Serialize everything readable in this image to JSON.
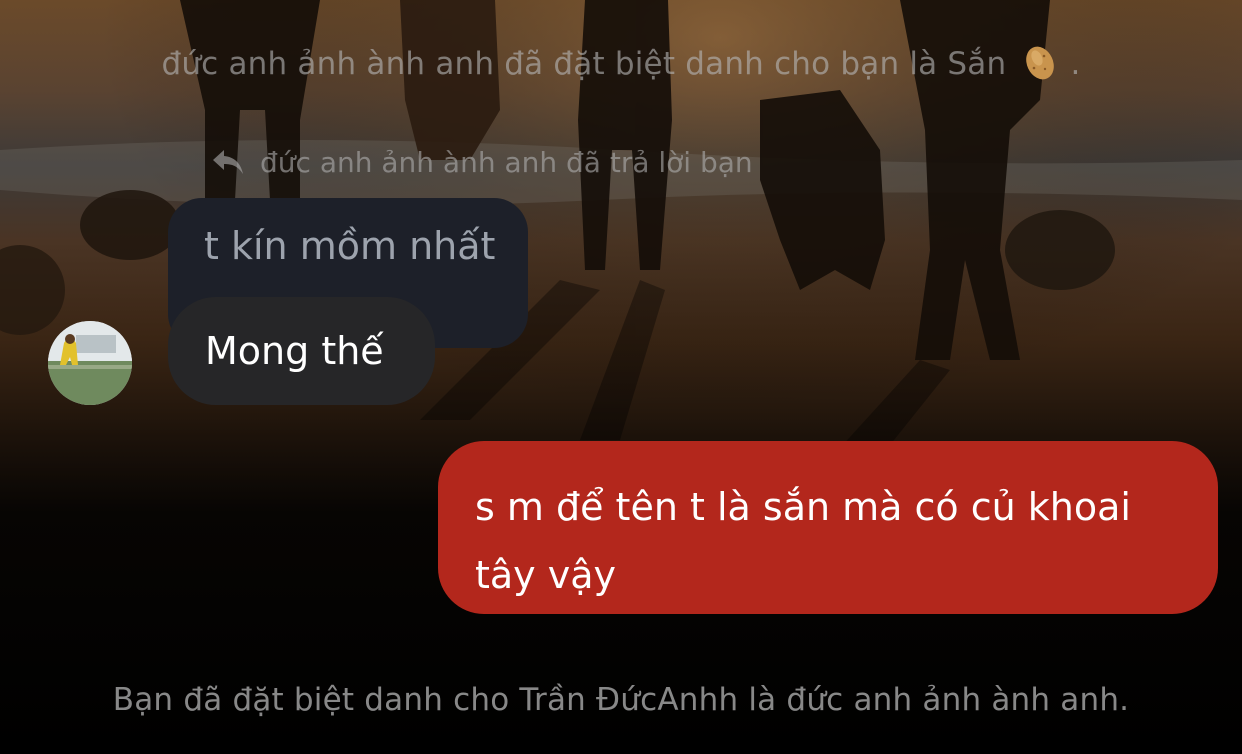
{
  "conversation": {
    "system_notes": {
      "top": "đức anh ảnh ành anh đã đặt biệt danh cho bạn là Sắn",
      "top_suffix": ".",
      "top_icon": "potato-icon",
      "bottom": "Bạn đã đặt biệt danh cho Trần ĐứcAnhh là đức anh ảnh ành anh."
    },
    "reply": {
      "icon": "reply-arrow-icon",
      "label": "đức anh ảnh ành anh đã trả lời bạn",
      "quoted_text": "t kín mồm nhất"
    },
    "messages": [
      {
        "side": "incoming",
        "text": "Mong thế"
      },
      {
        "side": "outgoing",
        "lines": [
          "s m để tên t là sắn mà có củ khoai",
          "tây vậy"
        ]
      }
    ],
    "colors": {
      "outgoing_bubble": "#b3271c",
      "incoming_bubble": "#262628",
      "quoted_bubble": "#1d2029",
      "background": "#000000"
    }
  }
}
